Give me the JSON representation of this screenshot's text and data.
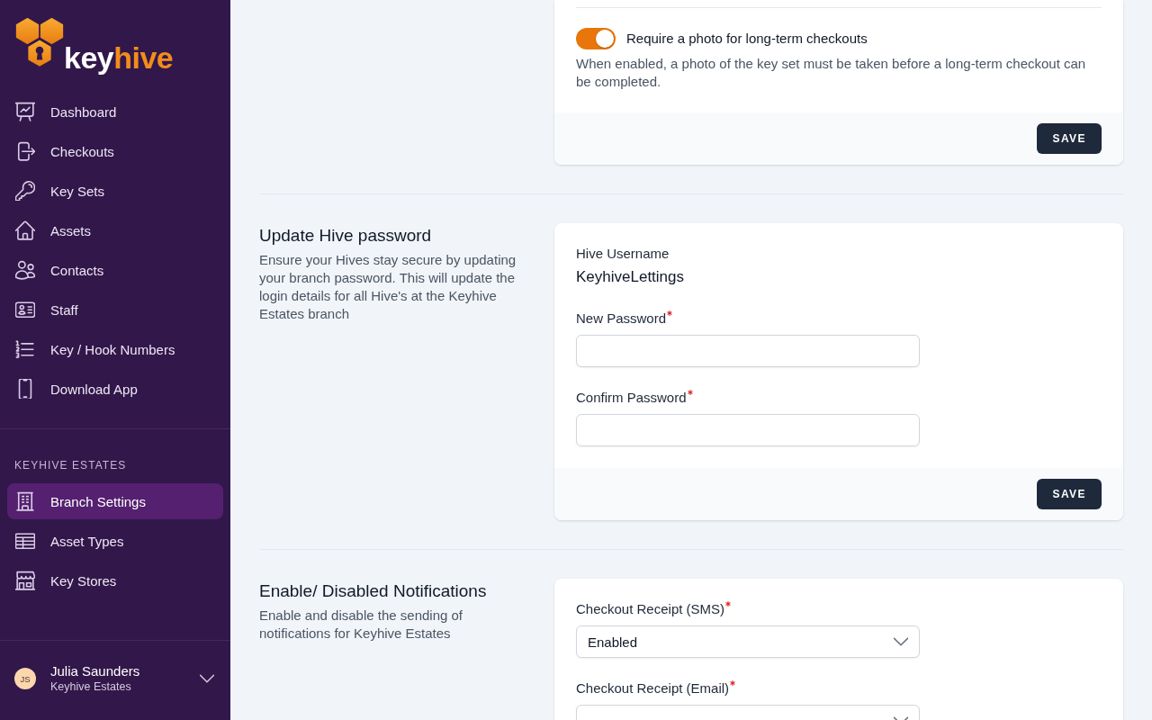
{
  "sidebar": {
    "logo": {
      "primary": "key",
      "accent": "hive"
    },
    "nav_items": [
      {
        "label": "Dashboard",
        "selected": false
      },
      {
        "label": "Checkouts",
        "selected": false
      },
      {
        "label": "Key Sets",
        "selected": false
      },
      {
        "label": "Assets",
        "selected": false
      },
      {
        "label": "Contacts",
        "selected": false
      },
      {
        "label": "Staff",
        "selected": false
      },
      {
        "label": "Key / Hook Numbers",
        "selected": false
      },
      {
        "label": "Download App",
        "selected": false
      }
    ],
    "branch_section": {
      "heading": "KEYHIVE ESTATES",
      "items": [
        {
          "label": "Branch Settings",
          "selected": true
        },
        {
          "label": "Asset Types",
          "selected": false
        },
        {
          "label": "Key Stores",
          "selected": false
        }
      ]
    },
    "user": {
      "initials": "JS",
      "name": "Julia Saunders",
      "organization": "Keyhive Estates"
    }
  },
  "sections": [
    {
      "fields": [
        {
          "kind": "toggle",
          "label": "Require a photo for long-term checkouts",
          "on": true,
          "description": "When enabled, a photo of the key set must be taken before a long-term checkout can be completed."
        }
      ],
      "button": "SAVE"
    },
    {
      "title": "Update Hive password",
      "description": "Ensure your Hives stay secure by updating your branch password. This will update the login details for all Hive's at the Keyhive Estates branch",
      "fields": [
        {
          "kind": "readonly",
          "label": "Hive Username",
          "value": "KeyhiveLettings"
        },
        {
          "kind": "password",
          "label": "New Password",
          "required": true
        },
        {
          "kind": "password",
          "label": "Confirm Password",
          "required": true
        }
      ],
      "button": "SAVE"
    },
    {
      "title": "Enable/ Disabled Notifications",
      "description": "Enable and disable the sending of notifications for Keyhive Estates",
      "fields": [
        {
          "kind": "select",
          "label": "Checkout Receipt (SMS)",
          "required": true,
          "value": "Enabled"
        },
        {
          "kind": "select",
          "label": "Checkout Receipt (Email)",
          "required": true
        }
      ]
    }
  ]
}
